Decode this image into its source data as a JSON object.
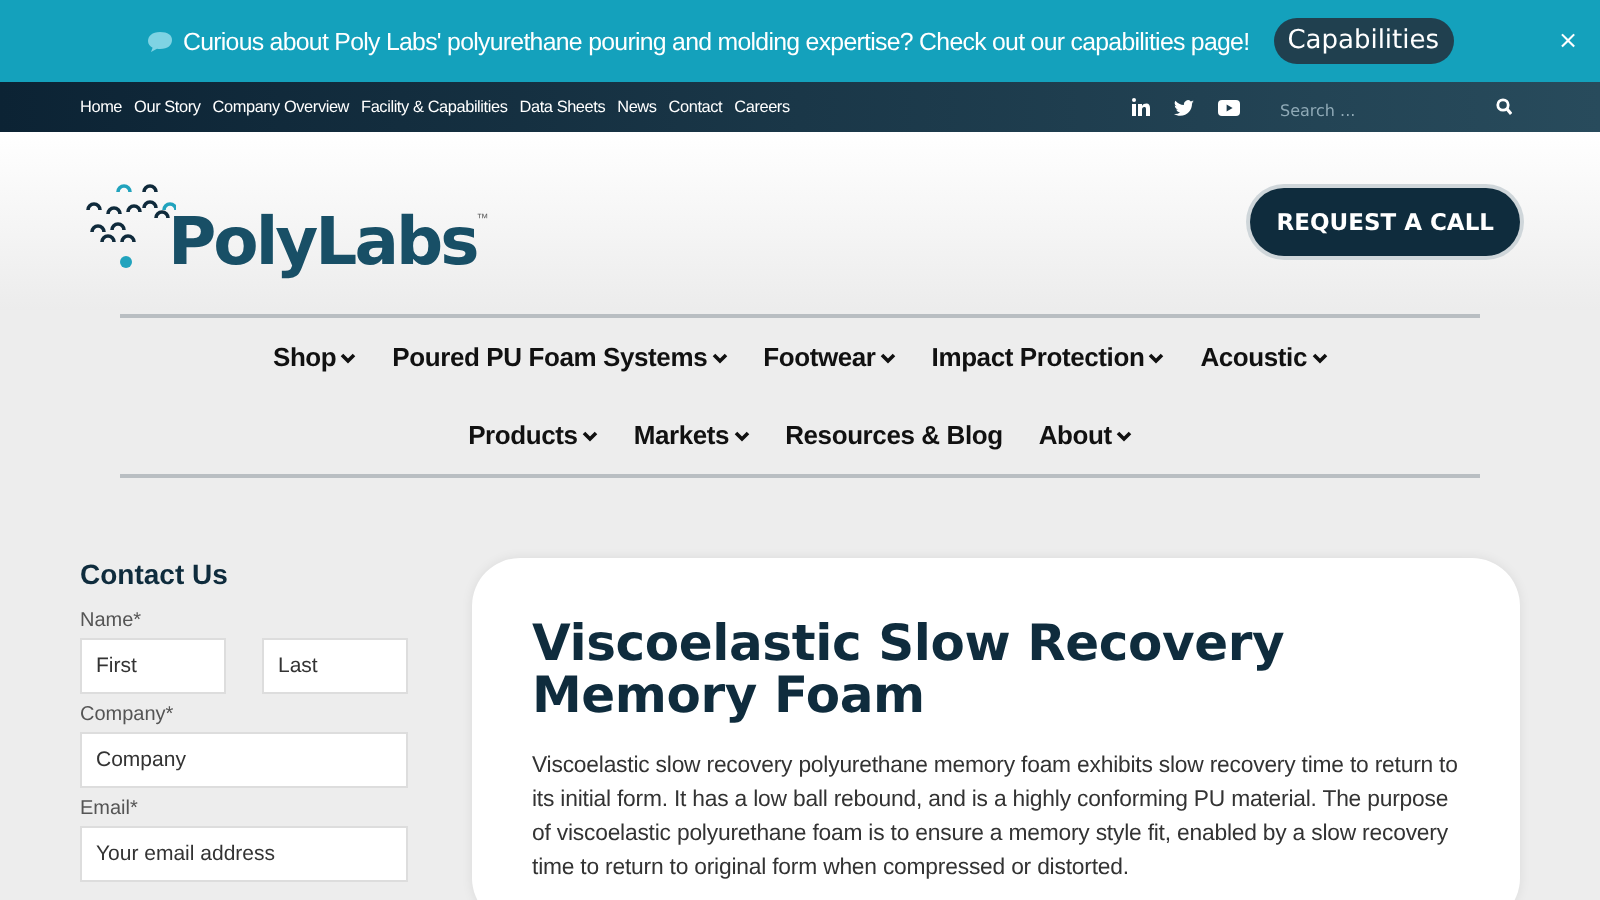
{
  "announcement": {
    "text": "Curious about Poly Labs' polyurethane pouring and molding expertise? Check out our capabilities page!",
    "button": "Capabilities",
    "close": "×"
  },
  "top_links": [
    "Home",
    "Our Story",
    "Company Overview",
    "Facility & Capabilities",
    "Data Sheets",
    "News",
    "Contact",
    "Careers"
  ],
  "search": {
    "placeholder": "Search ..."
  },
  "logo": {
    "text": "PolyLabs",
    "mark": "™"
  },
  "cta": "REQUEST A CALL",
  "nav": [
    {
      "label": "Shop",
      "dropdown": true
    },
    {
      "label": "Poured PU Foam Systems",
      "dropdown": true
    },
    {
      "label": "Footwear",
      "dropdown": true
    },
    {
      "label": "Impact Protection",
      "dropdown": true
    },
    {
      "label": "Acoustic",
      "dropdown": true
    },
    {
      "label": "Products",
      "dropdown": true
    },
    {
      "label": "Markets",
      "dropdown": true
    },
    {
      "label": "Resources & Blog",
      "dropdown": false
    },
    {
      "label": "About",
      "dropdown": true
    }
  ],
  "contact": {
    "title": "Contact Us",
    "fields": [
      {
        "label": "Name*",
        "inputs": [
          {
            "placeholder": "First"
          },
          {
            "placeholder": "Last"
          }
        ]
      },
      {
        "label": "Company*",
        "inputs": [
          {
            "placeholder": "Company"
          }
        ]
      },
      {
        "label": "Email*",
        "inputs": [
          {
            "placeholder": "Your email address"
          }
        ]
      }
    ]
  },
  "article": {
    "title": "Viscoelastic Slow Recovery Memory Foam",
    "body": "Viscoelastic slow recovery polyurethane memory foam exhibits slow recovery time to return to its initial form. It has a low ball rebound, and is a highly conforming PU material. The purpose of viscoelastic polyurethane foam is to ensure a memory style fit, enabled by a slow recovery time to return to original form when compressed or distorted."
  }
}
